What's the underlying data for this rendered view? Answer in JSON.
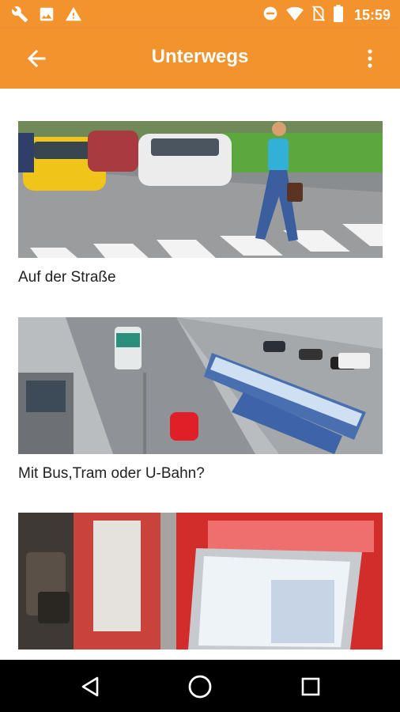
{
  "status": {
    "time": "15:59",
    "left_icons": [
      "wrench-icon",
      "image-icon",
      "warning-icon"
    ],
    "right_icons": [
      "do-not-disturb-icon",
      "wifi-icon",
      "no-sim-icon",
      "battery-icon"
    ]
  },
  "app_bar": {
    "title": "Unterwegs",
    "back_icon": "arrow-back-icon",
    "menu_icon": "more-vert-icon"
  },
  "cards": [
    {
      "label": "Auf der Straße",
      "image": "street-crosswalk-photo"
    },
    {
      "label": "Mit Bus,Tram oder U-Bahn?",
      "image": "tram-street-aerial-photo"
    },
    {
      "label": "",
      "image": "ticket-machine-photo"
    }
  ],
  "nav": {
    "back": "nav-back-icon",
    "home": "nav-home-icon",
    "recents": "nav-recents-icon"
  },
  "colors": {
    "accent": "#f2932e",
    "text": "#212121"
  }
}
